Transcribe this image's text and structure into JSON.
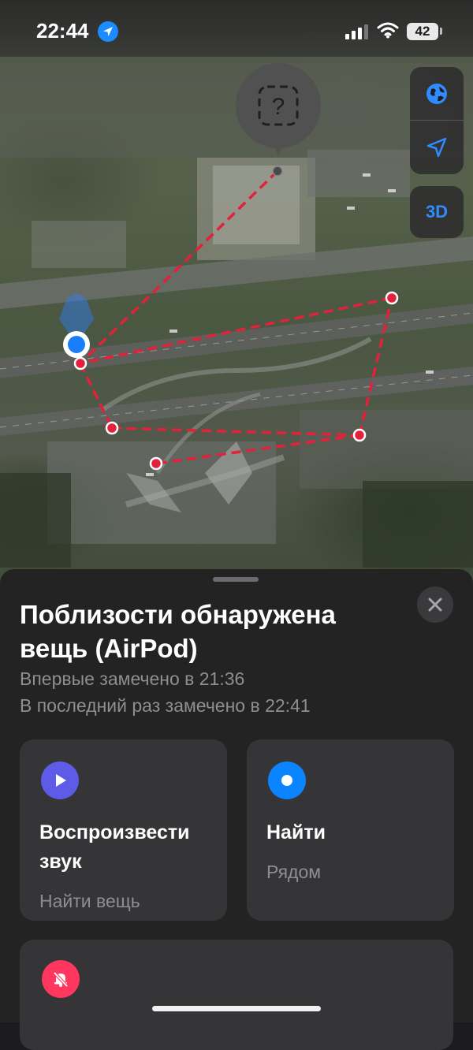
{
  "status_bar": {
    "time": "22:44",
    "battery": "42",
    "icons": [
      "location-arrow-icon",
      "cellular-signal-icon",
      "wifi-icon",
      "battery-icon"
    ]
  },
  "map": {
    "controls": {
      "globe_icon": "globe-icon",
      "locate_icon": "location-arrow-icon",
      "mode_label": "3D"
    },
    "unknown_item_pin_glyph": "?",
    "route_color": "#e3213a",
    "user_location_color": "#1a7dfa"
  },
  "sheet": {
    "title": "Поблизости обнаружена вещь (AirPod)",
    "first_seen": "Впервые замечено в 21:36",
    "last_seen": "В последний раз замечено в 22:41",
    "close_icon": "close-icon",
    "actions": [
      {
        "title": "Воспроизве­сти звук",
        "subtitle": "Найти вещь",
        "icon": "play-icon",
        "icon_color": "#5e5ce6"
      },
      {
        "title": "Найти",
        "subtitle": "Рядом",
        "icon": "find-nearby-icon",
        "icon_color": "#0a84ff"
      }
    ],
    "bottom_card_icon": "bell-slash-icon",
    "bottom_card_icon_color": "#ff375f"
  }
}
